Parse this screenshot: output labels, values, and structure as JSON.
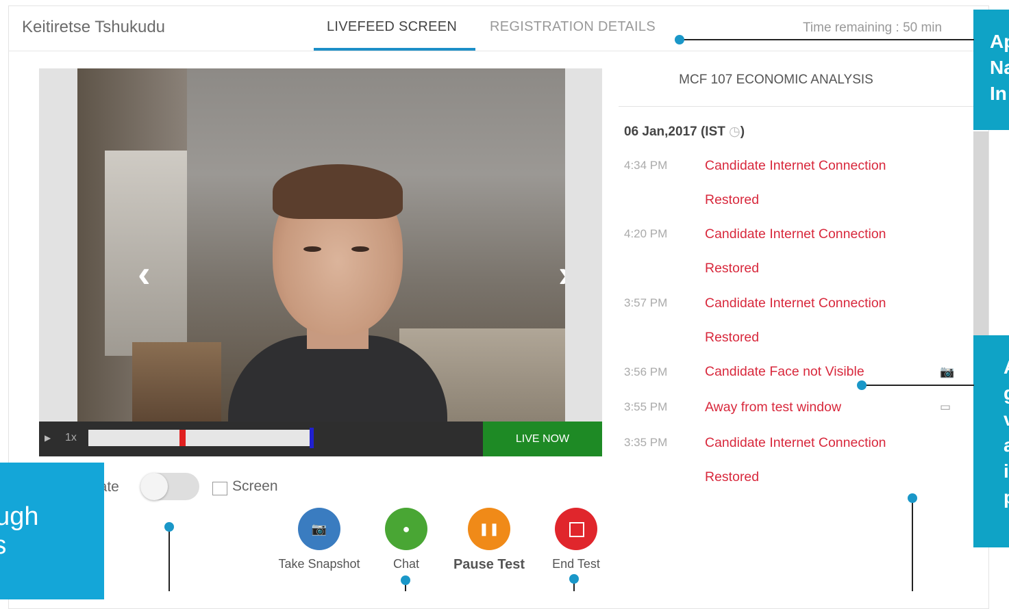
{
  "header": {
    "candidate_name": "Keitiretse Tshukudu",
    "tabs": [
      {
        "label": "LIVEFEED SCREEN",
        "active": true
      },
      {
        "label": "REGISTRATION DETAILS",
        "active": false
      }
    ],
    "time_remaining": "Time remaining : 50 min"
  },
  "video": {
    "speed": "1x",
    "live_label": "LIVE NOW",
    "progress_markers": {
      "red": 0.43,
      "blue": 1.0
    }
  },
  "options": {
    "toggle_label": "late",
    "screen_label": "Screen"
  },
  "actions": {
    "snapshot": "Take Snapshot",
    "chat": "Chat",
    "pause": "Pause Test",
    "end": "End Test"
  },
  "log": {
    "subject": "MCF 107 ECONOMIC ANALYSIS",
    "date": "06 Jan,2017 (IST ",
    "date_close": ")",
    "entries": [
      {
        "time": "4:34 PM",
        "line1": "Candidate Internet Connection",
        "line2": "Restored"
      },
      {
        "time": "4:20 PM",
        "line1": "Candidate Internet Connection",
        "line2": "Restored"
      },
      {
        "time": "3:57 PM",
        "line1": "Candidate Internet Connection",
        "line2": "Restored"
      },
      {
        "time": "3:56 PM",
        "line1": "Candidate Face not Visible",
        "icon": "camera-icon"
      },
      {
        "time": "3:55 PM",
        "line1": "Away from test window",
        "icon": "window-icon"
      },
      {
        "time": "3:35 PM",
        "line1": "Candidate Internet Connection",
        "line2": "Restored"
      }
    ]
  },
  "callouts": {
    "top_right": "Ap\nNa\nIn",
    "right": "A\ng\nv\na\ni\np",
    "bottom_left": [
      "ough",
      "t’s"
    ]
  },
  "colors": {
    "accent": "#1c8fc7",
    "alert_text": "#d8283c",
    "live_green": "#1e8a25",
    "callout": "#0fa3c6"
  }
}
